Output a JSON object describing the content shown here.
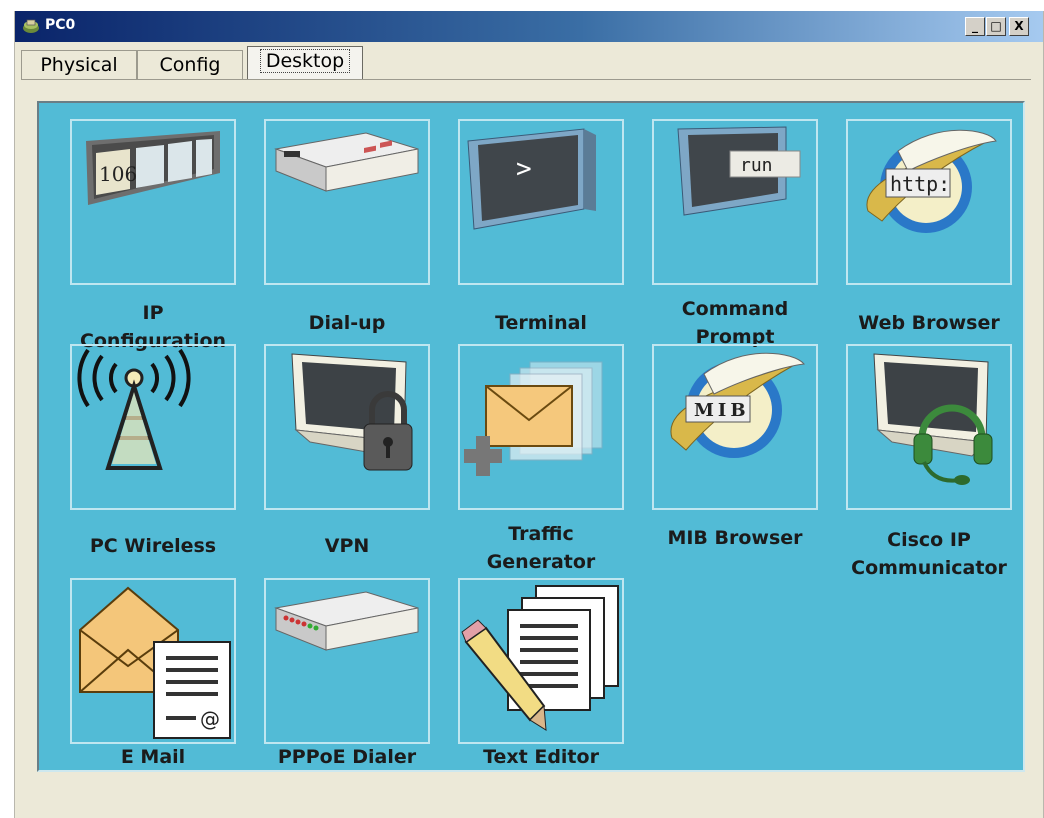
{
  "window": {
    "title": "PC0",
    "minimize": "_",
    "maximize": "□",
    "close": "X"
  },
  "tabs": [
    {
      "label": "Physical"
    },
    {
      "label": "Config"
    },
    {
      "label": "Desktop",
      "active": true
    }
  ],
  "desktop_apps": [
    {
      "label": "IP\nConfiguration",
      "icon": "ip-configuration-icon",
      "icon_text": "106"
    },
    {
      "label": "Dial-up",
      "icon": "modem-icon"
    },
    {
      "label": "Terminal",
      "icon": "terminal-icon",
      "icon_text": ">"
    },
    {
      "label": "Command\nPrompt",
      "icon": "command-prompt-icon",
      "icon_text": "run"
    },
    {
      "label": "Web Browser",
      "icon": "web-browser-icon",
      "icon_text": "http:"
    },
    {
      "label": "PC Wireless",
      "icon": "wireless-tower-icon"
    },
    {
      "label": "VPN",
      "icon": "vpn-lock-icon"
    },
    {
      "label": "Traffic\nGenerator",
      "icon": "traffic-generator-icon"
    },
    {
      "label": "MIB Browser",
      "icon": "mib-browser-icon",
      "icon_text": "MIB"
    },
    {
      "label": "Cisco IP\nCommunicator",
      "icon": "headset-icon"
    },
    {
      "label": "E Mail",
      "icon": "email-icon",
      "icon_text": "@"
    },
    {
      "label": "PPPoE Dialer",
      "icon": "pppoe-dialer-icon"
    },
    {
      "label": "Text Editor",
      "icon": "text-editor-icon"
    }
  ],
  "colors": {
    "desktop_bg": "#52bbd6",
    "titlebar": "#0a246a"
  }
}
